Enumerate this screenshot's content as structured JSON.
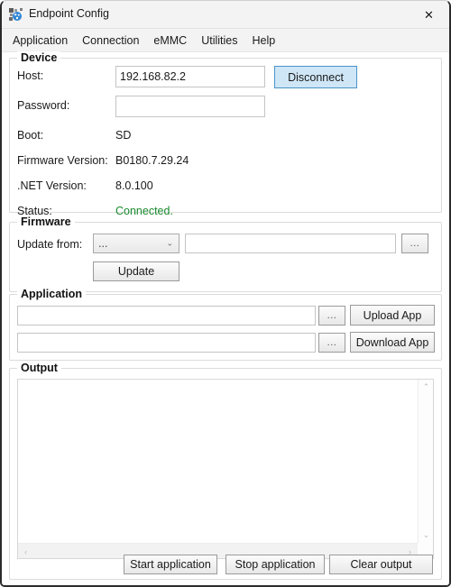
{
  "window": {
    "title": "Endpoint Config",
    "icon": "network-nodes-icon",
    "close_label": "✕"
  },
  "menubar": {
    "items": [
      {
        "label": "Application",
        "name": "menu-application"
      },
      {
        "label": "Connection",
        "name": "menu-connection"
      },
      {
        "label": "eMMC",
        "name": "menu-emmc"
      },
      {
        "label": "Utilities",
        "name": "menu-utilities"
      },
      {
        "label": "Help",
        "name": "menu-help"
      }
    ]
  },
  "device": {
    "legend": "Device",
    "host_label": "Host:",
    "host_value": "192.168.82.2",
    "host_placeholder": "",
    "password_label": "Password:",
    "password_value": "",
    "password_placeholder": "",
    "disconnect_label": "Disconnect",
    "boot_label": "Boot:",
    "boot_value": "SD",
    "firmware_version_label": "Firmware Version:",
    "firmware_version_value": "B0180.7.29.24",
    "net_version_label": ".NET Version:",
    "net_version_value": "8.0.100",
    "status_label": "Status:",
    "status_value": "Connected.",
    "status_color": "#1a8a2e"
  },
  "firmware": {
    "legend": "Firmware",
    "update_from_label": "Update from:",
    "source_selected": "...",
    "source_chevron": "⌄",
    "path_value": "",
    "path_placeholder": "",
    "browse_label": "...",
    "update_label": "Update"
  },
  "application": {
    "legend": "Application",
    "upload_path_value": "",
    "upload_path_placeholder": "",
    "upload_browse_label": "...",
    "upload_label": "Upload App",
    "download_path_value": "",
    "download_path_placeholder": "",
    "download_browse_label": "...",
    "download_label": "Download App"
  },
  "output": {
    "legend": "Output",
    "text": "",
    "scroll_up": "⌃",
    "scroll_down": "⌄",
    "scroll_left": "‹",
    "scroll_right": "›"
  },
  "actions": {
    "start_label": "Start application",
    "stop_label": "Stop application",
    "clear_label": "Clear output"
  },
  "theme": {
    "accent": "#cfe6f7",
    "accent_border": "#4a93c9",
    "success": "#1a8a2e",
    "window_bg": "#f3f3f3",
    "client_bg": "#ffffff"
  }
}
